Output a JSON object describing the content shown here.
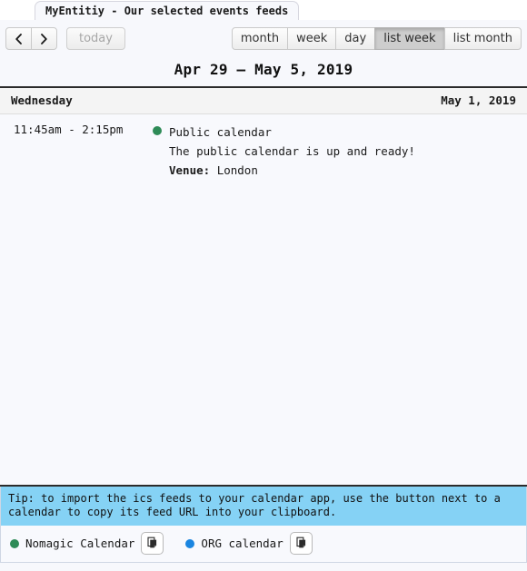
{
  "tab": {
    "title": "MyEntitiy - Our selected events feeds"
  },
  "toolbar": {
    "prev_label": "‹",
    "next_label": "›",
    "today_label": "today",
    "views": [
      {
        "label": "month",
        "active": false
      },
      {
        "label": "week",
        "active": false
      },
      {
        "label": "day",
        "active": false
      },
      {
        "label": "list week",
        "active": true
      },
      {
        "label": "list month",
        "active": false
      }
    ]
  },
  "calendar": {
    "title": "Apr 29 – May 5, 2019",
    "day": {
      "weekday": "Wednesday",
      "date": "May 1, 2019"
    },
    "events": [
      {
        "time": "11:45am - 2:15pm",
        "dot_color": "#2e8b57",
        "title": "Public calendar",
        "description": "The public calendar is up and ready!",
        "venue_label": "Venue:",
        "venue_value": "London"
      }
    ]
  },
  "footer": {
    "tip": "Tip: to import the ics feeds to your calendar app, use the button next to a calendar to copy its feed URL into your clipboard.",
    "legend": [
      {
        "name": "Nomagic Calendar",
        "color": "#2e8b57",
        "copy_icon": "copy-icon"
      },
      {
        "name": "ORG calendar",
        "color": "#1a85e0",
        "copy_icon": "copy-icon"
      }
    ]
  },
  "colors": {
    "accent_tip": "#85d2f5",
    "active_button": "#cdcdcd",
    "page_background": "#f7f8fc"
  }
}
